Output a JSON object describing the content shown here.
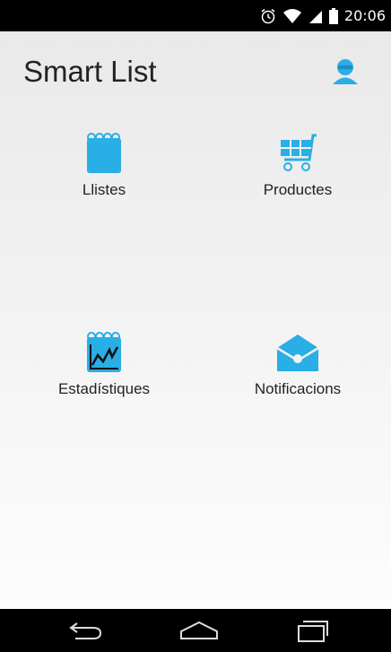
{
  "status_bar": {
    "time": "20:06",
    "icons": [
      "alarm-icon",
      "wifi-icon",
      "signal-icon",
      "battery-icon"
    ]
  },
  "app": {
    "title": "Smart List",
    "profile_icon": "user-icon",
    "accent_color": "#29aee6"
  },
  "menu": {
    "items": [
      {
        "label": "Llistes",
        "icon": "notepad-icon"
      },
      {
        "label": "Productes",
        "icon": "shopping-cart-icon"
      },
      {
        "label": "Estadístiques",
        "icon": "stats-chart-icon"
      },
      {
        "label": "Notificacions",
        "icon": "envelope-icon"
      }
    ]
  },
  "nav_bar": {
    "buttons": [
      "back-icon",
      "home-icon",
      "recent-apps-icon"
    ]
  }
}
